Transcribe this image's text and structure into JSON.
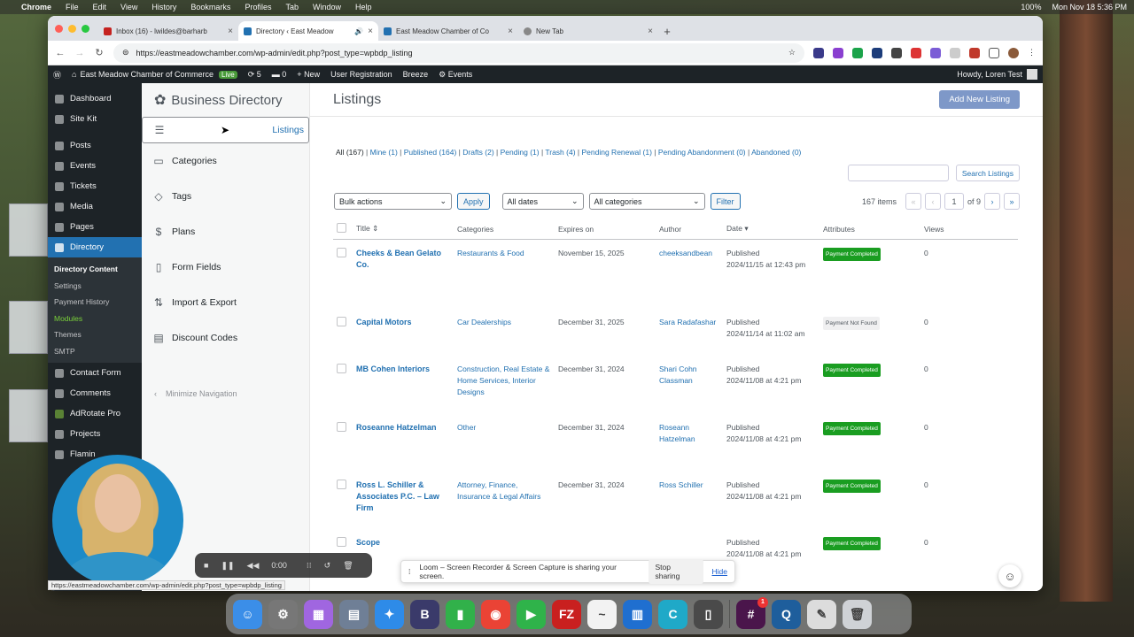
{
  "menubar": {
    "app": "Chrome",
    "items": [
      "File",
      "Edit",
      "View",
      "History",
      "Bookmarks",
      "Profiles",
      "Tab",
      "Window",
      "Help"
    ],
    "battery": "100%",
    "datetime": "Mon Nov 18  5:36 PM"
  },
  "browser": {
    "tabs": [
      {
        "title": "Inbox (16) - lwildes@barharb",
        "color": "#c5221f"
      },
      {
        "title": "Directory ‹ East Meadow",
        "color": "#2271b1",
        "active": true
      },
      {
        "title": "East Meadow Chamber of Co",
        "color": "#2271b1"
      },
      {
        "title": "New Tab",
        "color": "#777"
      }
    ],
    "url": "https://eastmeadowchamber.com/wp-admin/edit.php?post_type=wpbdp_listing"
  },
  "adminbar": {
    "site": "East Meadow Chamber of Commerce",
    "live": "Live",
    "updates": "5",
    "comments": "0",
    "new": "New",
    "links": [
      "User Registration",
      "Breeze",
      "Events"
    ],
    "howdy": "Howdy, Loren Test"
  },
  "sidemenu": {
    "items_top": [
      "Dashboard",
      "Site Kit"
    ],
    "items_mid": [
      "Posts",
      "Events",
      "Tickets",
      "Media",
      "Pages"
    ],
    "current": "Directory",
    "sub": [
      "Directory Content",
      "Settings",
      "Payment History",
      "Modules",
      "Themes",
      "SMTP"
    ],
    "items_bottom": [
      "Contact Form",
      "Comments",
      "AdRotate Pro",
      "Projects",
      "Flamin"
    ]
  },
  "bdnav": {
    "brand": "Business Directory",
    "items": [
      "Listings",
      "Categories",
      "Tags",
      "Plans",
      "Form Fields",
      "Import & Export",
      "Discount Codes"
    ],
    "minimize": "Minimize Navigation"
  },
  "main": {
    "title": "Listings",
    "add_new": "Add New Listing",
    "views": [
      {
        "label": "All",
        "count": "(167)"
      },
      {
        "label": "Mine",
        "count": "(1)"
      },
      {
        "label": "Published",
        "count": "(164)"
      },
      {
        "label": "Drafts",
        "count": "(2)"
      },
      {
        "label": "Pending",
        "count": "(1)"
      },
      {
        "label": "Trash",
        "count": "(4)"
      },
      {
        "label": "Pending Renewal",
        "count": "(1)"
      },
      {
        "label": "Pending Abandonment",
        "count": "(0)"
      },
      {
        "label": "Abandoned",
        "count": "(0)"
      }
    ],
    "search_btn": "Search Listings",
    "bulk": "Bulk actions",
    "apply": "Apply",
    "dates": "All dates",
    "cats": "All categories",
    "filter": "Filter",
    "items_count": "167 items",
    "page": "1",
    "of": "of 9",
    "columns": [
      "Title",
      "Categories",
      "Expires on",
      "Author",
      "Date",
      "Attributes",
      "Views"
    ],
    "rows": [
      {
        "title": "Cheeks & Bean Gelato Co.",
        "cat": "Restaurants & Food",
        "exp": "November 15, 2025",
        "author": "cheeksandbean",
        "status": "Published",
        "date": "2024/11/15 at 12:43 pm",
        "attr": "Payment Completed",
        "ok": true,
        "views": "0"
      },
      {
        "title": "Capital Motors",
        "cat": "Car Dealerships",
        "exp": "December 31, 2025",
        "author": "Sara Radafashar",
        "status": "Published",
        "date": "2024/11/14 at 11:02 am",
        "attr": "Payment Not Found",
        "ok": false,
        "views": "0"
      },
      {
        "title": "MB Cohen Interiors",
        "cat": "Construction, Real Estate & Home Services, Interior Designs",
        "exp": "December 31, 2024",
        "author": "Shari Cohn Classman",
        "status": "Published",
        "date": "2024/11/08 at 4:21 pm",
        "attr": "Payment Completed",
        "ok": true,
        "views": "0"
      },
      {
        "title": "Roseanne Hatzelman",
        "cat": "Other",
        "exp": "December 31, 2024",
        "author": "Roseann Hatzelman",
        "status": "Published",
        "date": "2024/11/08 at 4:21 pm",
        "attr": "Payment Completed",
        "ok": true,
        "views": "0"
      },
      {
        "title": "Ross L. Schiller & Associates P.C. – Law Firm",
        "cat": "Attorney, Finance, Insurance & Legal Affairs",
        "exp": "December 31, 2024",
        "author": "Ross Schiller",
        "status": "Published",
        "date": "2024/11/08 at 4:21 pm",
        "attr": "Payment Completed",
        "ok": true,
        "views": "0"
      },
      {
        "title": "Scope",
        "cat": "",
        "exp": "",
        "author": "",
        "status": "Published",
        "date": "2024/11/08 at 4:21 pm",
        "attr": "Payment Completed",
        "ok": true,
        "views": "0"
      }
    ]
  },
  "overlay": {
    "timer": "0:00",
    "loom_text": "Loom – Screen Recorder & Screen Capture is sharing your screen.",
    "stop": "Stop sharing",
    "hide": "Hide",
    "status_url": "https://eastmeadowchamber.com/wp-admin/edit.php?post_type=wpbdp_listing"
  },
  "dock": [
    {
      "name": "finder",
      "color": "#3b8ee8",
      "g": "☺"
    },
    {
      "name": "settings",
      "color": "#777",
      "g": "⚙"
    },
    {
      "name": "launchpad",
      "color": "#a066e0",
      "g": "▦"
    },
    {
      "name": "preview",
      "color": "#6f7f96",
      "g": "▤"
    },
    {
      "name": "safari",
      "color": "#2e8be8",
      "g": "✦"
    },
    {
      "name": "bbedit",
      "color": "#3a3a6a",
      "g": "B"
    },
    {
      "name": "numbers",
      "color": "#31b14a",
      "g": "▮"
    },
    {
      "name": "chrome",
      "color": "#ea4335",
      "g": "◉"
    },
    {
      "name": "facetime",
      "color": "#2fb34a",
      "g": "▶"
    },
    {
      "name": "filezilla",
      "color": "#c9201f",
      "g": "FZ"
    },
    {
      "name": "freeform",
      "color": "#f2f2f2",
      "g": "~"
    },
    {
      "name": "trello",
      "color": "#1f6fd0",
      "g": "▥"
    },
    {
      "name": "canva",
      "color": "#1fa9c8",
      "g": "C"
    },
    {
      "name": "iphone-mirroring",
      "color": "#4a4a4a",
      "g": "▯"
    },
    {
      "name": "slack",
      "color": "#4a154b",
      "g": "#",
      "badge": "1"
    },
    {
      "name": "quicktime",
      "color": "#1e5e9c",
      "g": "Q"
    },
    {
      "name": "textedit",
      "color": "#dcdcdc",
      "g": "✎"
    },
    {
      "name": "trash",
      "color": "#cfd2d6",
      "g": "🗑"
    }
  ]
}
